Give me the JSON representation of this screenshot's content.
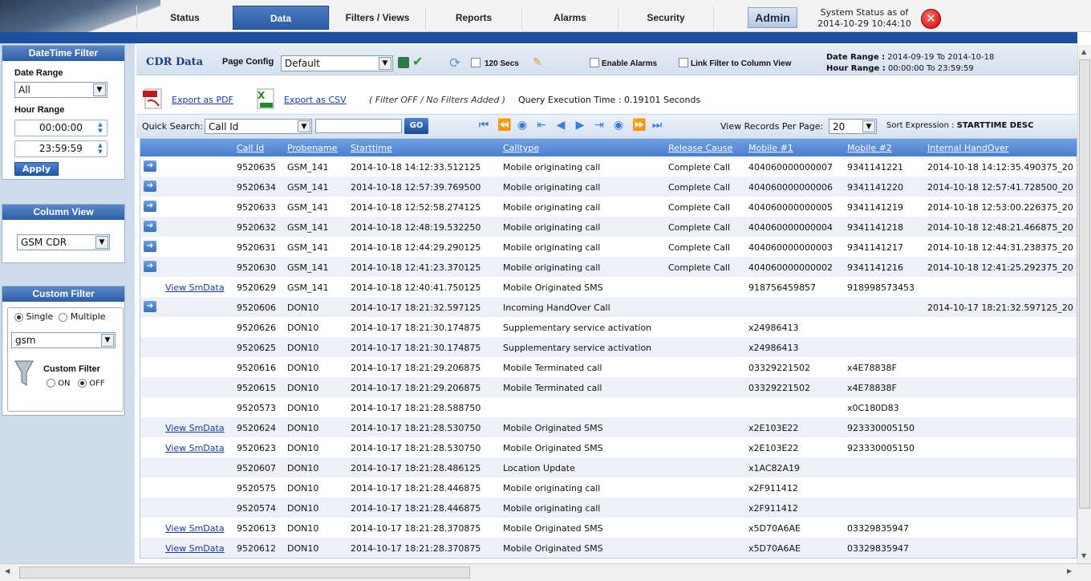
{
  "nav": {
    "tabs": [
      {
        "label": "Status"
      },
      {
        "label": "Data"
      },
      {
        "label": "Filters / Views"
      },
      {
        "label": "Reports"
      },
      {
        "label": "Alarms"
      },
      {
        "label": "Security"
      }
    ],
    "admin_label": "Admin",
    "status_line1": "System Status as of",
    "status_line2": "2014-10-29 10:44:10",
    "close_symbol": "✕"
  },
  "sidebar": {
    "datetime": {
      "title": "DateTime Filter",
      "date_range_label": "Date Range",
      "date_range_value": "All",
      "hour_range_label": "Hour Range",
      "from_time": "00:00:00",
      "to_time": "23:59:59",
      "apply_label": "Apply"
    },
    "column_view": {
      "title": "Column View",
      "value": "GSM CDR"
    },
    "custom_filter": {
      "title": "Custom Filter",
      "single_label": "Single",
      "multiple_label": "Multiple",
      "select_value": "gsm",
      "filter_label": "Custom Filter",
      "on_label": "ON",
      "off_label": "OFF"
    }
  },
  "main": {
    "title": "CDR Data",
    "page_config_label": "Page Config",
    "page_config_value": "Default",
    "refresh_label": "120 Secs",
    "enable_alarms_label": "Enable Alarms",
    "link_filter_label": "Link Filter to Column View",
    "date_range_label": "Date Range :",
    "date_range_value": "2014-09-19 To 2014-10-18",
    "hour_range_label": "Hour Range :",
    "hour_range_value": "00:00:00 To 23:59:59",
    "export_pdf": "Export as PDF",
    "export_csv": "Export as CSV",
    "filter_status": "( Filter OFF / No Filters Added )",
    "query_time": "Query Execution Time : 0.19101 Seconds",
    "quick_search_label": "Quick Search:",
    "quick_search_field": "Call Id",
    "go_label": "GO",
    "per_page_label": "View Records Per Page:",
    "per_page_value": "20",
    "sort_label": "Sort Expression :",
    "sort_value": "STARTTIME DESC"
  },
  "table": {
    "columns": [
      "Call Id",
      "Probename",
      "Starttime",
      "Calltype",
      "Release Cause",
      "Mobile #1",
      "Mobile #2",
      "Internal HandOver"
    ],
    "rows": [
      {
        "icon": true,
        "link": "",
        "callid": "9520635",
        "probe": "GSM_141",
        "start": "2014-10-18 14:12:33.512125",
        "calltype": "Mobile originating call",
        "release": "Complete Call",
        "m1": "404060000000007",
        "m2": "9341141221",
        "iho": "2014-10-18 14:12:35.490375_20"
      },
      {
        "icon": true,
        "link": "",
        "callid": "9520634",
        "probe": "GSM_141",
        "start": "2014-10-18 12:57:39.769500",
        "calltype": "Mobile originating call",
        "release": "Complete Call",
        "m1": "404060000000006",
        "m2": "9341141220",
        "iho": "2014-10-18 12:57:41.728500_20"
      },
      {
        "icon": true,
        "link": "",
        "callid": "9520633",
        "probe": "GSM_141",
        "start": "2014-10-18 12:52:58.274125",
        "calltype": "Mobile originating call",
        "release": "Complete Call",
        "m1": "404060000000005",
        "m2": "9341141219",
        "iho": "2014-10-18 12:53:00.226375_20"
      },
      {
        "icon": true,
        "link": "",
        "callid": "9520632",
        "probe": "GSM_141",
        "start": "2014-10-18 12:48:19.532250",
        "calltype": "Mobile originating call",
        "release": "Complete Call",
        "m1": "404060000000004",
        "m2": "9341141218",
        "iho": "2014-10-18 12:48:21.466875_20"
      },
      {
        "icon": true,
        "link": "",
        "callid": "9520631",
        "probe": "GSM_141",
        "start": "2014-10-18 12:44:29.290125",
        "calltype": "Mobile originating call",
        "release": "Complete Call",
        "m1": "404060000000003",
        "m2": "9341141217",
        "iho": "2014-10-18 12:44:31.238375_20"
      },
      {
        "icon": true,
        "link": "",
        "callid": "9520630",
        "probe": "GSM_141",
        "start": "2014-10-18 12:41:23.370125",
        "calltype": "Mobile originating call",
        "release": "Complete Call",
        "m1": "404060000000002",
        "m2": "9341141216",
        "iho": "2014-10-18 12:41:25.292375_20"
      },
      {
        "icon": false,
        "link": "View SmData",
        "callid": "9520629",
        "probe": "GSM_141",
        "start": "2014-10-18 12:40:41.750125",
        "calltype": "Mobile Originated SMS",
        "release": "",
        "m1": "918756459857",
        "m2": "918998573453",
        "iho": ""
      },
      {
        "icon": true,
        "link": "",
        "callid": "9520606",
        "probe": "DON10",
        "start": "2014-10-17 18:21:32.597125",
        "calltype": "Incoming HandOver Call",
        "release": "",
        "m1": "",
        "m2": "",
        "iho": "2014-10-17 18:21:32.597125_20"
      },
      {
        "icon": false,
        "link": "",
        "callid": "9520626",
        "probe": "DON10",
        "start": "2014-10-17 18:21:30.174875",
        "calltype": "Supplementary service activation",
        "release": "",
        "m1": "x24986413",
        "m2": "",
        "iho": ""
      },
      {
        "icon": false,
        "link": "",
        "callid": "9520625",
        "probe": "DON10",
        "start": "2014-10-17 18:21:30.174875",
        "calltype": "Supplementary service activation",
        "release": "",
        "m1": "x24986413",
        "m2": "",
        "iho": ""
      },
      {
        "icon": false,
        "link": "",
        "callid": "9520616",
        "probe": "DON10",
        "start": "2014-10-17 18:21:29.206875",
        "calltype": "Mobile Terminated call",
        "release": "",
        "m1": "03329221502",
        "m2": "x4E78838F",
        "iho": ""
      },
      {
        "icon": false,
        "link": "",
        "callid": "9520615",
        "probe": "DON10",
        "start": "2014-10-17 18:21:29.206875",
        "calltype": "Mobile Terminated call",
        "release": "",
        "m1": "03329221502",
        "m2": "x4E78838F",
        "iho": ""
      },
      {
        "icon": false,
        "link": "",
        "callid": "9520573",
        "probe": "DON10",
        "start": "2014-10-17 18:21:28.588750",
        "calltype": "",
        "release": "",
        "m1": "",
        "m2": "x0C180D83",
        "iho": ""
      },
      {
        "icon": false,
        "link": "View SmData",
        "callid": "9520624",
        "probe": "DON10",
        "start": "2014-10-17 18:21:28.530750",
        "calltype": "Mobile Originated SMS",
        "release": "",
        "m1": "x2E103E22",
        "m2": "923330005150",
        "iho": ""
      },
      {
        "icon": false,
        "link": "View SmData",
        "callid": "9520623",
        "probe": "DON10",
        "start": "2014-10-17 18:21:28.530750",
        "calltype": "Mobile Originated SMS",
        "release": "",
        "m1": "x2E103E22",
        "m2": "923330005150",
        "iho": ""
      },
      {
        "icon": false,
        "link": "",
        "callid": "9520607",
        "probe": "DON10",
        "start": "2014-10-17 18:21:28.486125",
        "calltype": "Location Update",
        "release": "",
        "m1": "x1AC82A19",
        "m2": "",
        "iho": ""
      },
      {
        "icon": false,
        "link": "",
        "callid": "9520575",
        "probe": "DON10",
        "start": "2014-10-17 18:21:28.446875",
        "calltype": "Mobile originating call",
        "release": "",
        "m1": "x2F911412",
        "m2": "",
        "iho": ""
      },
      {
        "icon": false,
        "link": "",
        "callid": "9520574",
        "probe": "DON10",
        "start": "2014-10-17 18:21:28.446875",
        "calltype": "Mobile originating call",
        "release": "",
        "m1": "x2F911412",
        "m2": "",
        "iho": ""
      },
      {
        "icon": false,
        "link": "View SmData",
        "callid": "9520613",
        "probe": "DON10",
        "start": "2014-10-17 18:21:28.370875",
        "calltype": "Mobile Originated SMS",
        "release": "",
        "m1": "x5D70A6AE",
        "m2": "03329835947",
        "iho": ""
      },
      {
        "icon": false,
        "link": "View SmData",
        "callid": "9520612",
        "probe": "DON10",
        "start": "2014-10-17 18:21:28.370875",
        "calltype": "Mobile Originated SMS",
        "release": "",
        "m1": "x5D70A6AE",
        "m2": "03329835947",
        "iho": ""
      }
    ]
  }
}
